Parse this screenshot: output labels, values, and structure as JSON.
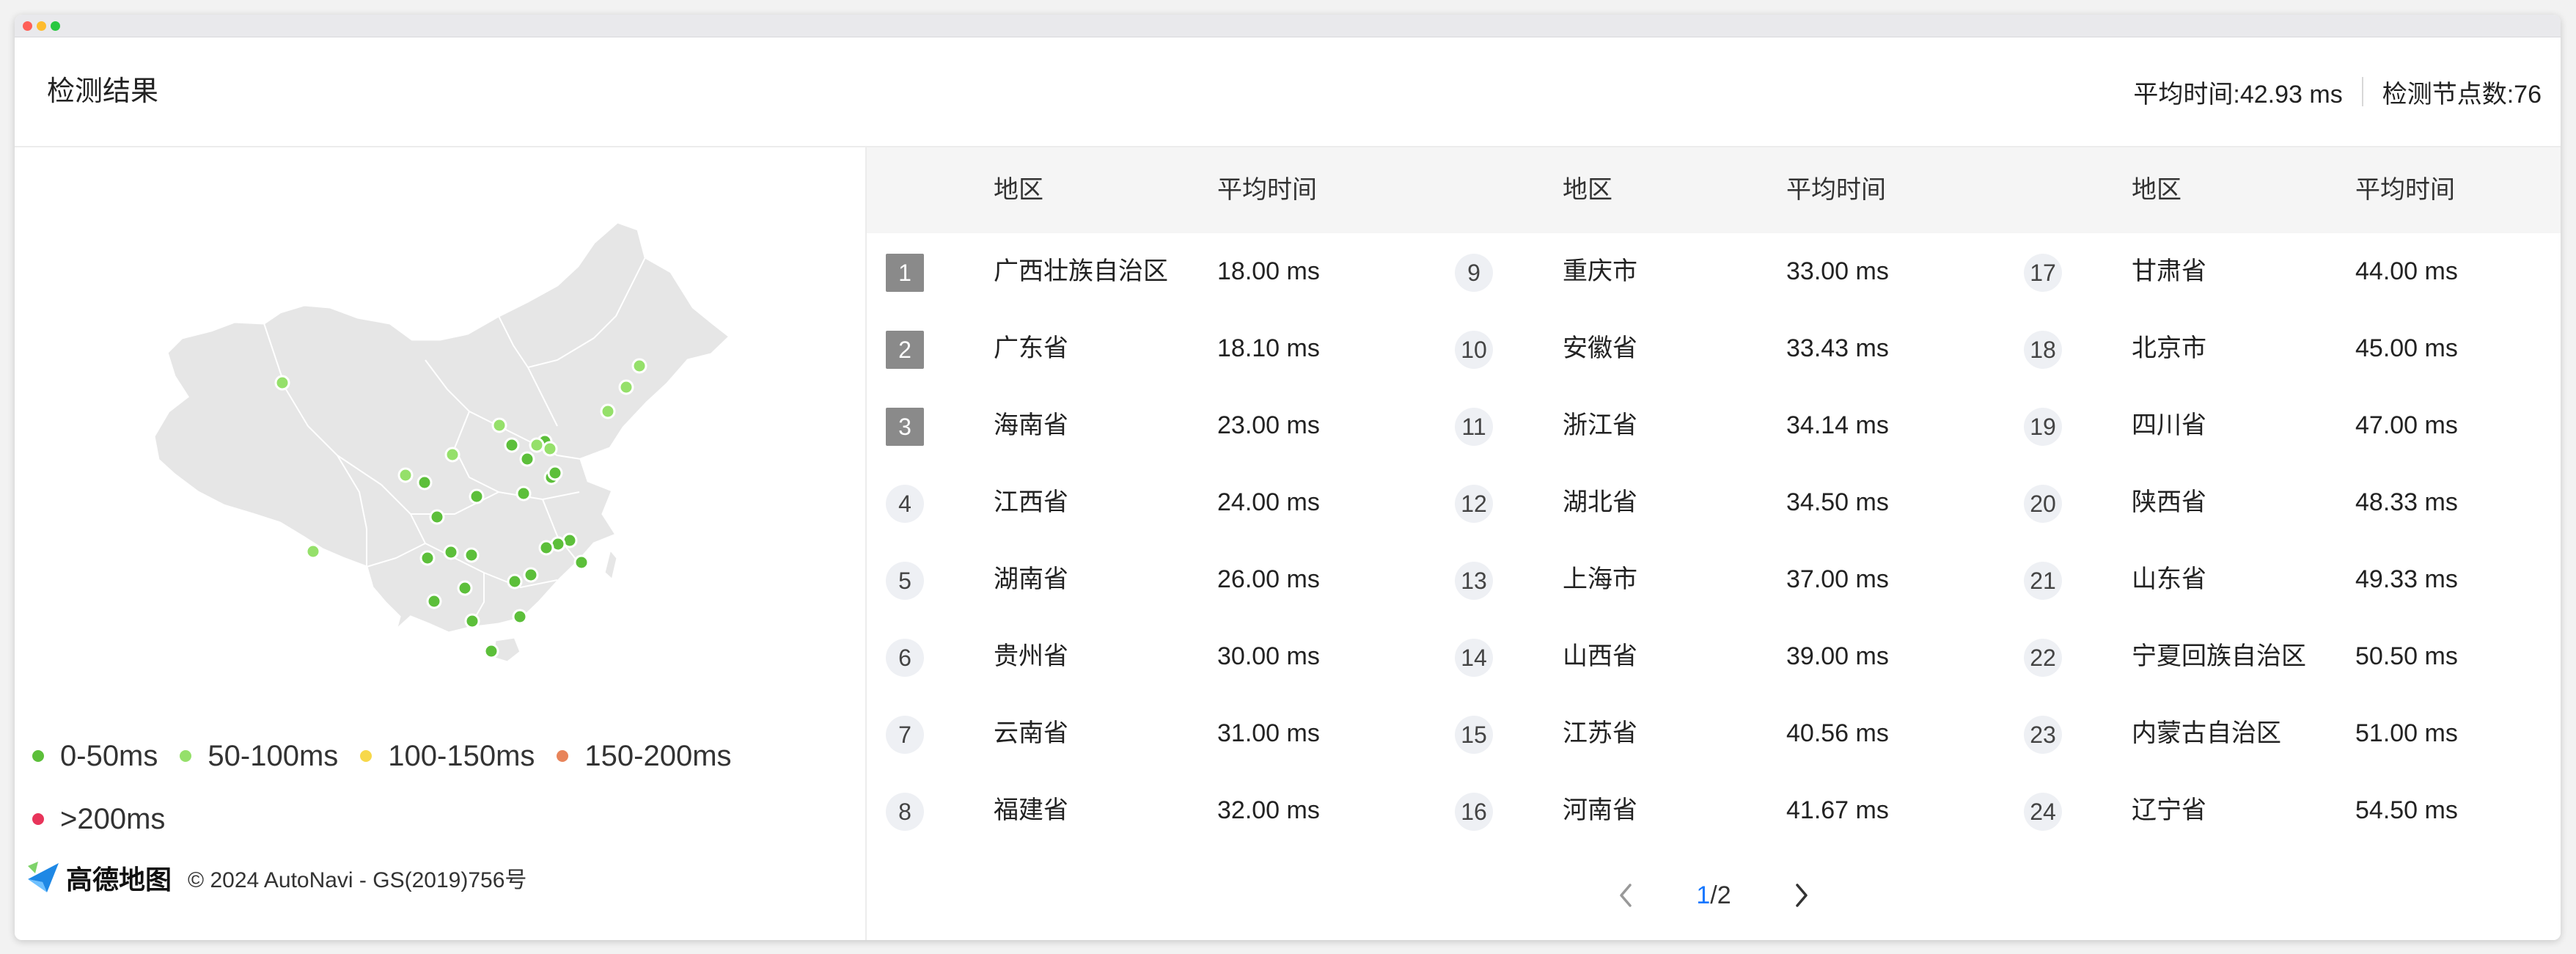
{
  "header": {
    "title": "检测结果",
    "avg_time": "平均时间:42.93 ms",
    "node_count": "检测节点数:76"
  },
  "table": {
    "col_region": "地区",
    "col_avg": "平均时间",
    "columns": [
      [
        {
          "rank": "1",
          "region": "广西壮族自治区",
          "avg": "18.00 ms"
        },
        {
          "rank": "2",
          "region": "广东省",
          "avg": "18.10 ms"
        },
        {
          "rank": "3",
          "region": "海南省",
          "avg": "23.00 ms"
        },
        {
          "rank": "4",
          "region": "江西省",
          "avg": "24.00 ms"
        },
        {
          "rank": "5",
          "region": "湖南省",
          "avg": "26.00 ms"
        },
        {
          "rank": "6",
          "region": "贵州省",
          "avg": "30.00 ms"
        },
        {
          "rank": "7",
          "region": "云南省",
          "avg": "31.00 ms"
        },
        {
          "rank": "8",
          "region": "福建省",
          "avg": "32.00 ms"
        }
      ],
      [
        {
          "rank": "9",
          "region": "重庆市",
          "avg": "33.00 ms"
        },
        {
          "rank": "10",
          "region": "安徽省",
          "avg": "33.43 ms"
        },
        {
          "rank": "11",
          "region": "浙江省",
          "avg": "34.14 ms"
        },
        {
          "rank": "12",
          "region": "湖北省",
          "avg": "34.50 ms"
        },
        {
          "rank": "13",
          "region": "上海市",
          "avg": "37.00 ms"
        },
        {
          "rank": "14",
          "region": "山西省",
          "avg": "39.00 ms"
        },
        {
          "rank": "15",
          "region": "江苏省",
          "avg": "40.56 ms"
        },
        {
          "rank": "16",
          "region": "河南省",
          "avg": "41.67 ms"
        }
      ],
      [
        {
          "rank": "17",
          "region": "甘肃省",
          "avg": "44.00 ms"
        },
        {
          "rank": "18",
          "region": "北京市",
          "avg": "45.00 ms"
        },
        {
          "rank": "19",
          "region": "四川省",
          "avg": "47.00 ms"
        },
        {
          "rank": "20",
          "region": "陕西省",
          "avg": "48.33 ms"
        },
        {
          "rank": "21",
          "region": "山东省",
          "avg": "49.33 ms"
        },
        {
          "rank": "22",
          "region": "宁夏回族自治区",
          "avg": "50.50 ms"
        },
        {
          "rank": "23",
          "region": "内蒙古自治区",
          "avg": "51.00 ms"
        },
        {
          "rank": "24",
          "region": "辽宁省",
          "avg": "54.50 ms"
        }
      ]
    ]
  },
  "pagination": {
    "current": "1",
    "total": "/2"
  },
  "legend": [
    {
      "label": "0-50ms",
      "color": "#5cbf3a"
    },
    {
      "label": "50-100ms",
      "color": "#95e06a"
    },
    {
      "label": "100-150ms",
      "color": "#f7d84a"
    },
    {
      "label": "150-200ms",
      "color": "#e8845a"
    },
    {
      "label": ">200ms",
      "color": "#e8345a"
    }
  ],
  "attribution": {
    "brand": "高德地图",
    "copyright": "© 2024 AutoNavi - GS(2019)756号"
  },
  "colors": {
    "map_fill": "#e6e6e6",
    "map_border": "#ffffff",
    "accent": "#1677ff",
    "top_rank_bg": "#8a8a8a"
  }
}
